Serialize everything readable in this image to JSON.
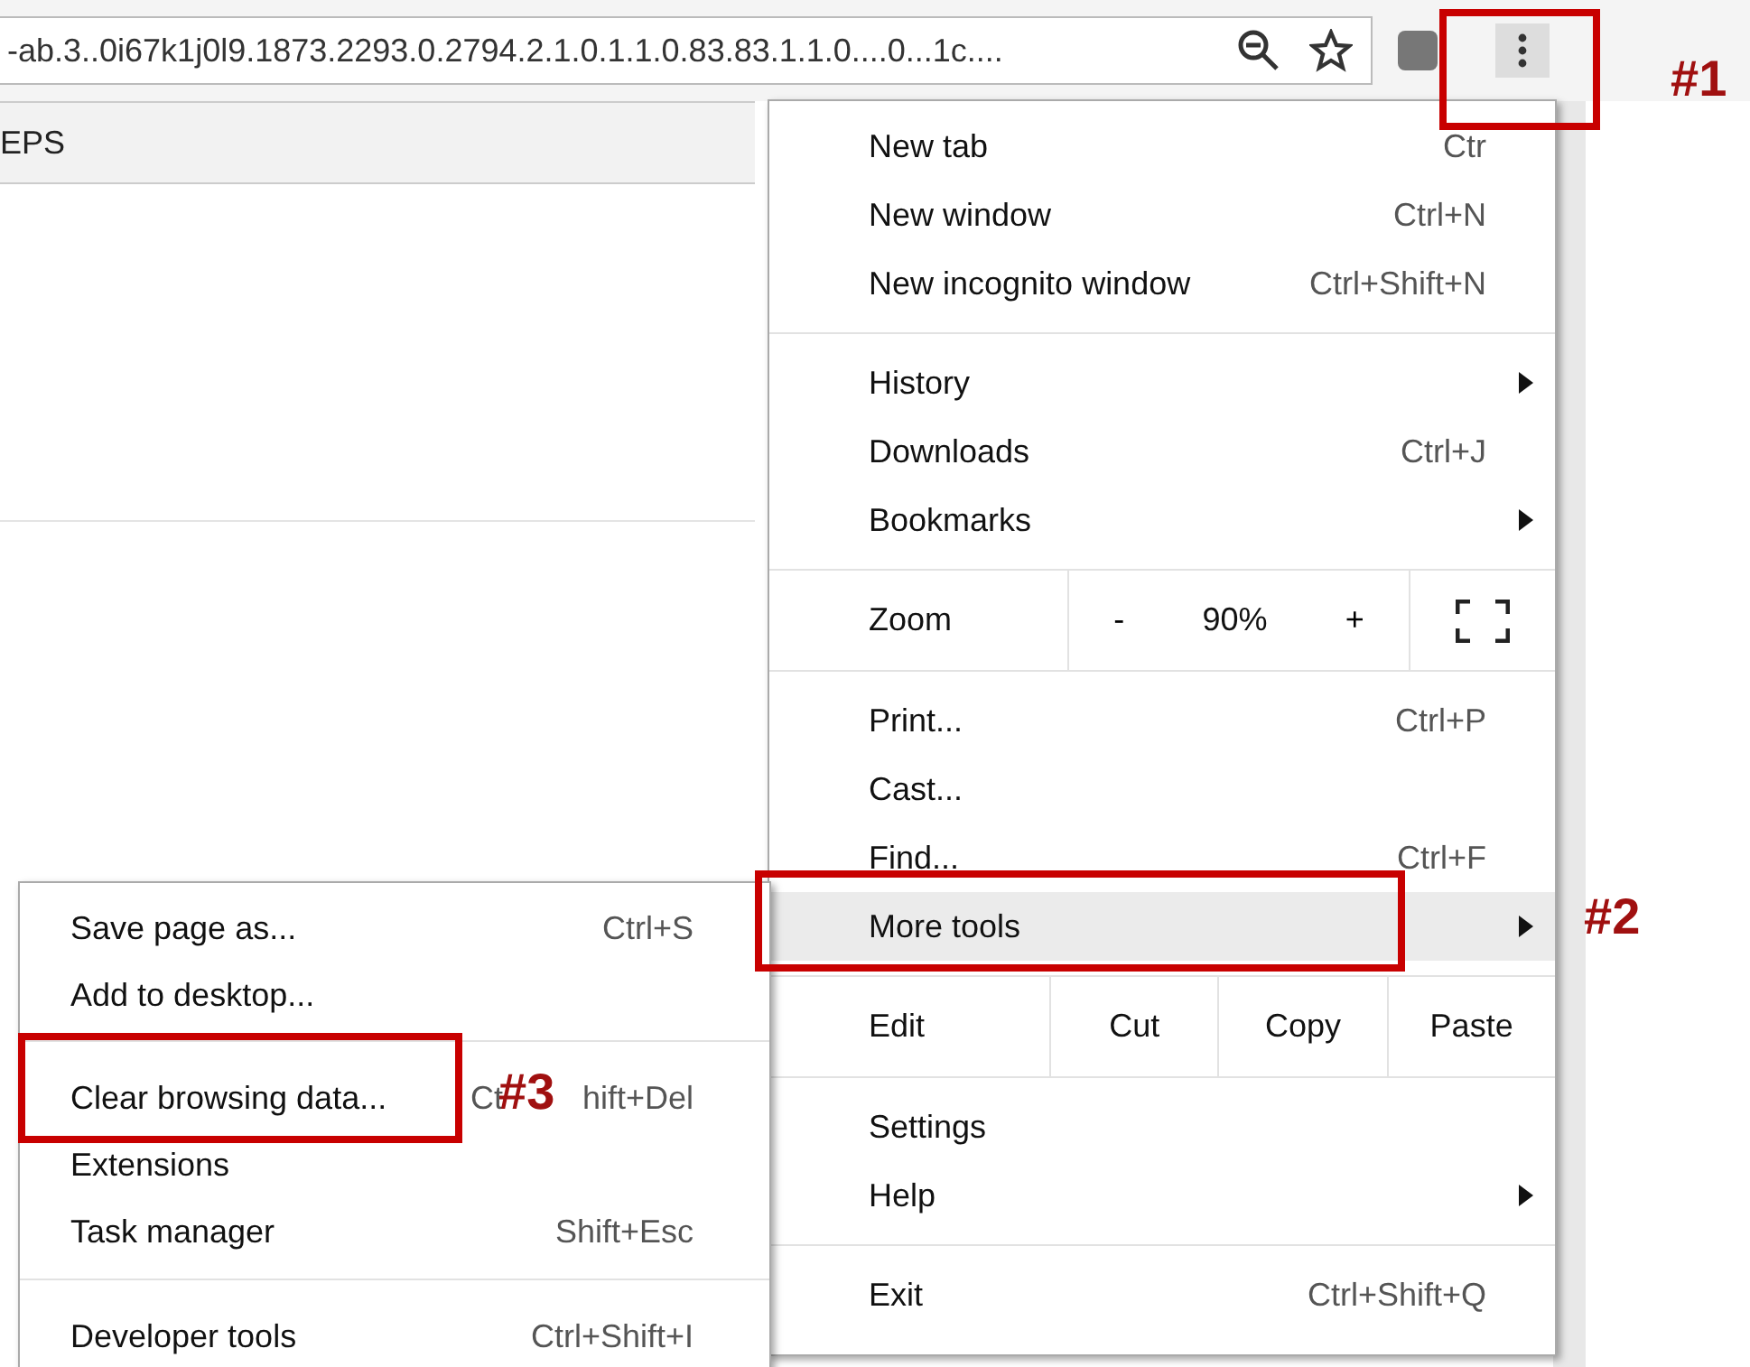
{
  "toolbar": {
    "url": "-ab.3..0i67k1j0l9.1873.2293.0.2794.2.1.0.1.1.0.83.83.1.1.0....0...1c...."
  },
  "page": {
    "column_1": "EPS"
  },
  "menu": {
    "sections": [
      {
        "rows": [
          {
            "kind": "item",
            "label": "New tab",
            "shortcut": "Ctr",
            "submenu": false,
            "highlighted": false
          },
          {
            "kind": "item",
            "label": "New window",
            "shortcut": "Ctrl+N",
            "submenu": false,
            "highlighted": false
          },
          {
            "kind": "item",
            "label": "New incognito window",
            "shortcut": "Ctrl+Shift+N",
            "submenu": false,
            "highlighted": false
          }
        ]
      },
      {
        "rows": [
          {
            "kind": "item",
            "label": "History",
            "submenu": true,
            "highlighted": false
          },
          {
            "kind": "item",
            "label": "Downloads",
            "shortcut": "Ctrl+J",
            "submenu": false,
            "highlighted": false
          },
          {
            "kind": "item",
            "label": "Bookmarks",
            "submenu": true,
            "highlighted": false
          }
        ]
      },
      {
        "rows": [
          {
            "kind": "zoom",
            "label": "Zoom",
            "minus": "-",
            "value": "90%",
            "plus": "+"
          }
        ]
      },
      {
        "rows": [
          {
            "kind": "item",
            "label": "Print...",
            "shortcut": "Ctrl+P",
            "submenu": false,
            "highlighted": false
          },
          {
            "kind": "item",
            "label": "Cast...",
            "submenu": false,
            "highlighted": false
          },
          {
            "kind": "item",
            "label": "Find...",
            "shortcut": "Ctrl+F",
            "submenu": false,
            "highlighted": false
          },
          {
            "kind": "item",
            "label": "More tools",
            "submenu": true,
            "highlighted": true
          }
        ]
      },
      {
        "rows": [
          {
            "kind": "edit",
            "label": "Edit",
            "buttons": [
              "Cut",
              "Copy",
              "Paste"
            ]
          }
        ]
      },
      {
        "rows": [
          {
            "kind": "item",
            "label": "Settings",
            "submenu": false,
            "highlighted": false
          },
          {
            "kind": "item",
            "label": "Help",
            "submenu": true,
            "highlighted": false
          }
        ]
      },
      {
        "rows": [
          {
            "kind": "item",
            "label": "Exit",
            "shortcut": "Ctrl+Shift+Q",
            "submenu": false,
            "highlighted": false
          }
        ]
      }
    ]
  },
  "submenu": {
    "sections": [
      {
        "rows": [
          {
            "label": "Save page as...",
            "shortcut": "Ctrl+S"
          },
          {
            "label": "Add to desktop..."
          }
        ]
      },
      {
        "rows": [
          {
            "label": "Clear browsing data...",
            "shortcut_parts": [
              "Ct",
              "hift+Del"
            ]
          },
          {
            "label": "Extensions"
          },
          {
            "label": "Task manager",
            "shortcut": "Shift+Esc"
          }
        ]
      },
      {
        "rows": [
          {
            "label": "Developer tools",
            "shortcut": "Ctrl+Shift+I"
          }
        ]
      }
    ]
  },
  "annotations": [
    {
      "label": "#1"
    },
    {
      "label": "#2"
    },
    {
      "label": "#3"
    }
  ]
}
